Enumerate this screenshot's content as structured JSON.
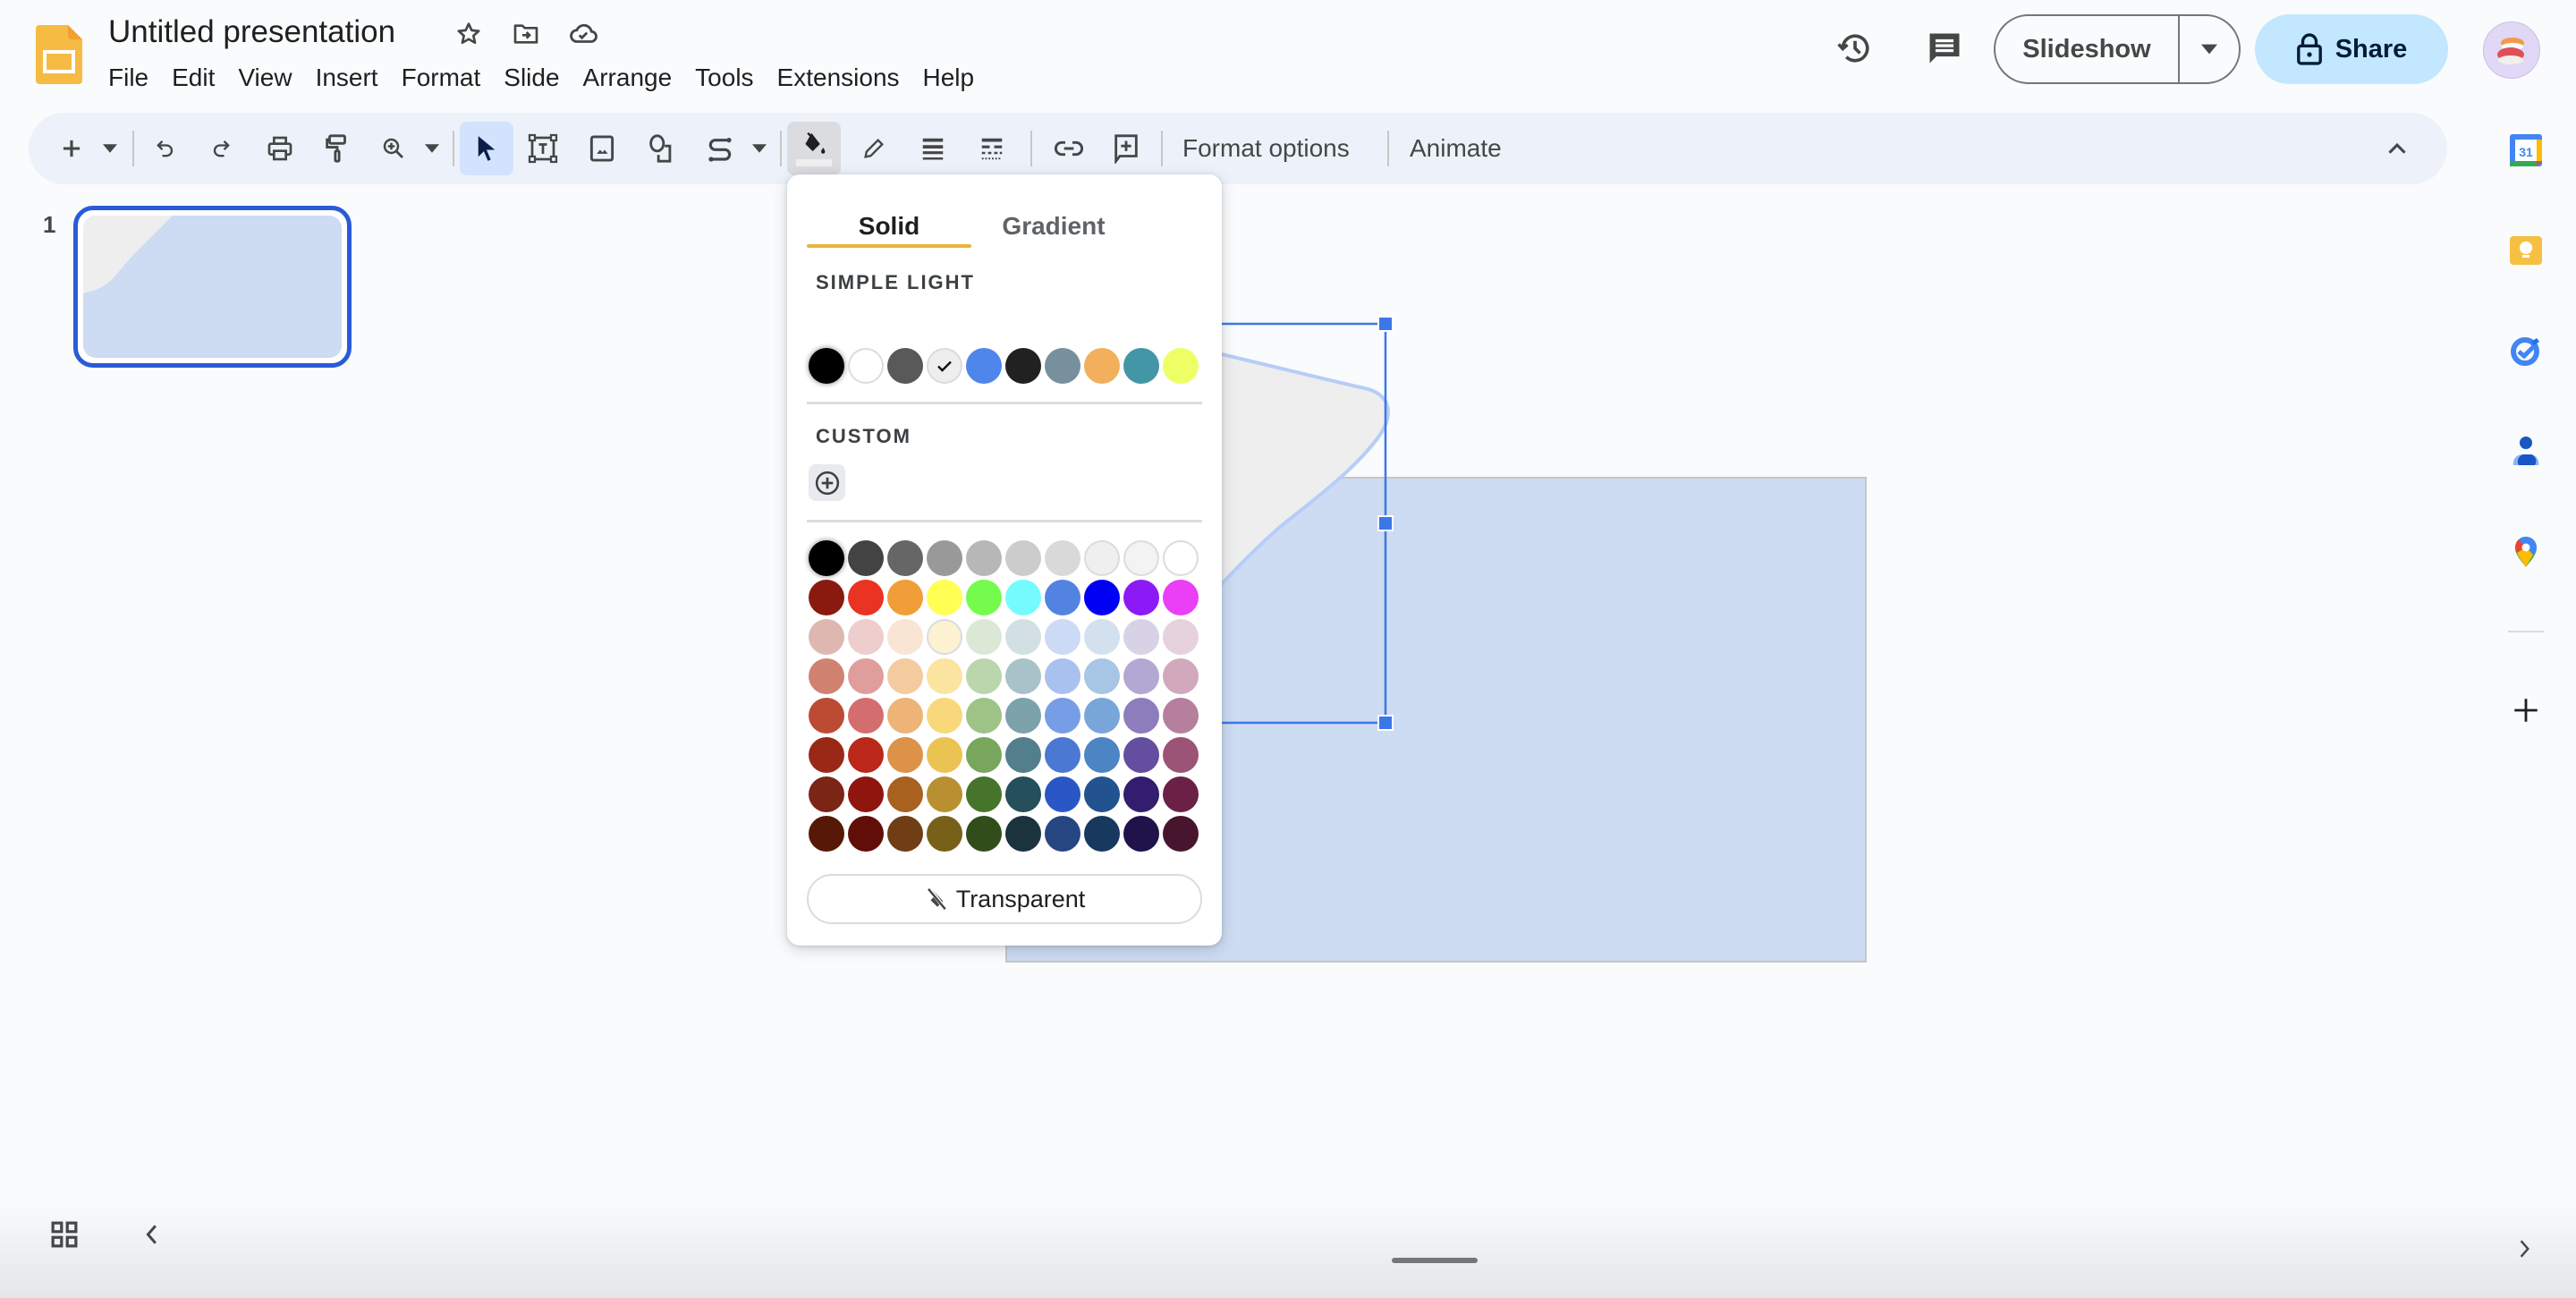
{
  "app": {
    "name": "Google Slides",
    "document_title": "Untitled presentation",
    "title_icons": [
      "star-icon",
      "move-to-folder-icon",
      "cloud-saved-icon"
    ]
  },
  "menu": [
    "File",
    "Edit",
    "View",
    "Insert",
    "Format",
    "Slide",
    "Arrange",
    "Tools",
    "Extensions",
    "Help"
  ],
  "header": {
    "history_icon": "version-history-icon",
    "comments_icon": "comments-icon",
    "slideshow_label": "Slideshow",
    "share_label": "Share",
    "share_color": "#c2e7ff"
  },
  "toolbar": {
    "items": [
      "new-slide",
      "new-slide-dropdown",
      "undo",
      "redo",
      "print",
      "paint-format",
      "zoom",
      "zoom-dropdown",
      "select",
      "text-box",
      "image",
      "shape",
      "line",
      "line-dropdown",
      "fill-color",
      "border-color",
      "border-weight",
      "border-dash",
      "insert-link",
      "add-comment"
    ],
    "format_options": "Format options",
    "animate": "Animate",
    "fill_indicator_color": "#eeeeee"
  },
  "filmstrip": {
    "slides": [
      {
        "number": "1",
        "selected": true
      }
    ]
  },
  "canvas": {
    "background_color": "#cddbf3",
    "shape_fill": "#eeeeee",
    "shape_outline": "#b6cdf7",
    "selection_color": "#3b78e7"
  },
  "fill_popup": {
    "tabs": [
      {
        "label": "Solid",
        "active": true
      },
      {
        "label": "Gradient",
        "active": false
      }
    ],
    "accent_color": "#e8b43a",
    "theme_label": "SIMPLE LIGHT",
    "theme_colors": [
      "#000000",
      "#ffffff",
      "#595959",
      "#eeeeee",
      "#4f86ec",
      "#212121",
      "#78909c",
      "#f2b05c",
      "#4296a6",
      "#eeff66"
    ],
    "theme_selected_index": 3,
    "custom_label": "CUSTOM",
    "custom_add_icon": "add-circle-icon",
    "palette": [
      [
        "#000000",
        "#434343",
        "#666666",
        "#999999",
        "#b7b7b7",
        "#cccccc",
        "#d9d9d9",
        "#efefef",
        "#f3f3f3",
        "#ffffff"
      ],
      [
        "#980000",
        "#ff0000",
        "#ff9900",
        "#ffff00",
        "#00ff00",
        "#00ffff",
        "#4a86e8",
        "#0000ff",
        "#9900ff",
        "#ff00ff"
      ],
      [
        "#e6b8af",
        "#f4cccc",
        "#fce5cd",
        "#fff2cc",
        "#d9ead3",
        "#d0e0e3",
        "#c9daf8",
        "#cfe2f3",
        "#d9d2e9",
        "#ead1dc"
      ],
      [
        "#dd7e6b",
        "#ea9999",
        "#f9cb9c",
        "#ffe599",
        "#b6d7a8",
        "#a2c4c9",
        "#a4c2f4",
        "#9fc5e8",
        "#b4a7d6",
        "#d5a6bd"
      ],
      [
        "#cc4125",
        "#e06666",
        "#f6b26b",
        "#ffd966",
        "#93c47d",
        "#76a5af",
        "#6d9eeb",
        "#6fa8dc",
        "#8e7cc3",
        "#c27ba0"
      ],
      [
        "#a61c00",
        "#cc0000",
        "#e69138",
        "#f1c232",
        "#6aa84f",
        "#45818e",
        "#3c78d8",
        "#3d85c6",
        "#674ea7",
        "#a64d79"
      ],
      [
        "#85200c",
        "#990000",
        "#b45f06",
        "#bf9000",
        "#38761d",
        "#134f5c",
        "#1155cc",
        "#0b5394",
        "#351c75",
        "#741b47"
      ],
      [
        "#5b0f00",
        "#660000",
        "#783f04",
        "#7f6000",
        "#274e13",
        "#0c343d",
        "#1c4587",
        "#073763",
        "#20124d",
        "#4c1130"
      ]
    ],
    "palette_display": [
      [
        "#000000",
        "#434343",
        "#666666",
        "#999999",
        "#b7b7b7",
        "#cccccc",
        "#d9d9d9",
        "#efefef",
        "#f3f3f3",
        "#ffffff"
      ],
      [
        "#8a1a10",
        "#ea3323",
        "#f19e38",
        "#ffff54",
        "#75fb4c",
        "#75fbfd",
        "#5383e0",
        "#0000f5",
        "#8c1af6",
        "#ea3ff7"
      ],
      [
        "#deb8b0",
        "#eecdcd",
        "#f9e5d3",
        "#fcf2d2",
        "#dce8d6",
        "#d3e0e3",
        "#ccdaf6",
        "#d3e1ef",
        "#d8d2e7",
        "#e6d2dc"
      ],
      [
        "#d08270",
        "#df9d9b",
        "#f4ca9f",
        "#fbe3a0",
        "#bbd6ac",
        "#a8c3c8",
        "#a9c1ee",
        "#a7c5e5",
        "#b3a7d3",
        "#d1a8bc"
      ],
      [
        "#bc4b34",
        "#d46d6d",
        "#edb377",
        "#f8d87a",
        "#9dc387",
        "#7ca2ab",
        "#779de6",
        "#79a6d8",
        "#8d7dbd",
        "#b57f9d"
      ],
      [
        "#992817",
        "#bb2719",
        "#dc9249",
        "#ebc352",
        "#77a65c",
        "#527f8b",
        "#4b78d2",
        "#4d84c3",
        "#634ea0",
        "#9b5376"
      ],
      [
        "#7b2517",
        "#8f150f",
        "#a9611f",
        "#b99031",
        "#46742a",
        "#244f5b",
        "#2a56c6",
        "#235290",
        "#331d6f",
        "#6a2145"
      ],
      [
        "#581808",
        "#610d08",
        "#6f3e14",
        "#776119",
        "#314e1a",
        "#1a333c",
        "#264682",
        "#17385f",
        "#1f1349",
        "#47162e"
      ]
    ],
    "transparent_label": "Transparent",
    "transparent_icon": "no-fill-icon"
  },
  "side_panel": {
    "apps": [
      "calendar-icon",
      "keep-icon",
      "tasks-icon",
      "contacts-icon",
      "maps-icon"
    ],
    "add_icon": "add-addon-icon"
  },
  "bottom": {
    "grid_icon": "grid-view-icon",
    "collapse_icon": "chevron-left-icon",
    "expand_icon": "chevron-right-icon"
  }
}
